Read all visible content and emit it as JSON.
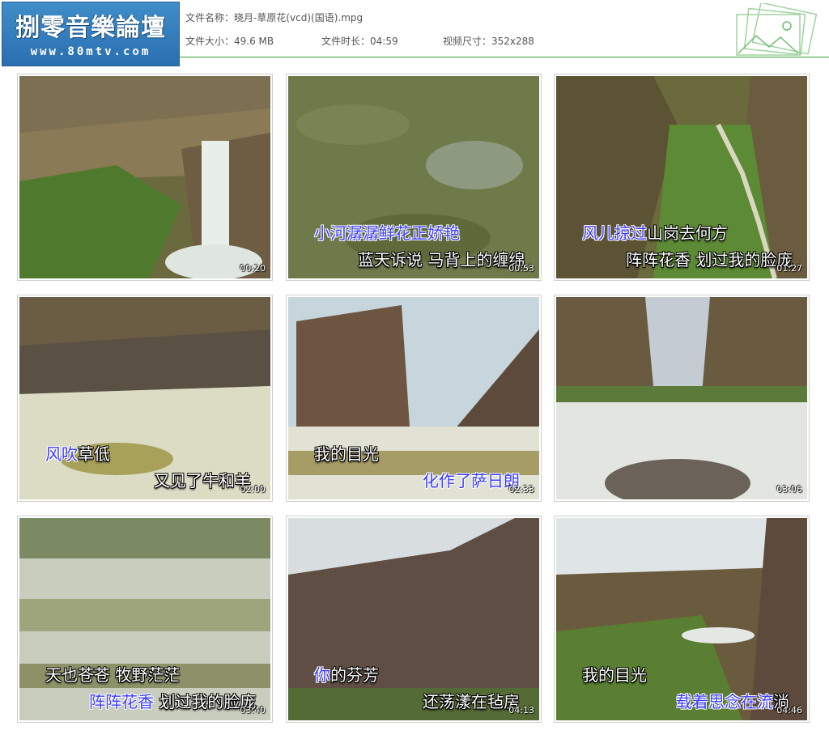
{
  "logo": {
    "title": "捌零音樂論壇",
    "url": "www.80mtv.com"
  },
  "file": {
    "name_label": "文件名称：",
    "name_value": "晓月-草原花(vcd)(国语).mpg",
    "size_label": "文件大小：",
    "size_value": "49.6 MB",
    "duration_label": "文件时长：",
    "duration_value": "04:59",
    "dims_label": "视频尺寸：",
    "dims_value": "352x288"
  },
  "thumbnails": [
    {
      "time": "00:20",
      "line1_hl": "",
      "line1_rest": "",
      "line2_hl": "",
      "line2_rest": ""
    },
    {
      "time": "00:53",
      "line1_hl": "小河潺潺鲜花正娇艳",
      "line1_rest": "",
      "line2_hl": "",
      "line2_rest": "蓝天诉说 马背上的缠绵"
    },
    {
      "time": "01:27",
      "line1_hl": "风儿掠过",
      "line1_rest": "山岗去何方",
      "line2_hl": "",
      "line2_rest": "阵阵花香 划过我的脸庞"
    },
    {
      "time": "02:00",
      "line1_hl": "风吹",
      "line1_rest": "草低",
      "line2_hl": "",
      "line2_rest": "又见了牛和羊"
    },
    {
      "time": "02:33",
      "line1_hl": "",
      "line1_rest": "我的目光",
      "line2_hl": "化作了萨日朗",
      "line2_rest": ""
    },
    {
      "time": "03:06",
      "line1_hl": "",
      "line1_rest": "",
      "line2_hl": "",
      "line2_rest": ""
    },
    {
      "time": "03:40",
      "line1_hl": "",
      "line1_rest": "天也苍苍 牧野茫茫",
      "line2_hl": "阵阵花香",
      "line2_rest": " 划过我的脸庞"
    },
    {
      "time": "04:13",
      "line1_hl": "你",
      "line1_rest": "的芬芳",
      "line2_hl": "",
      "line2_rest": "还荡漾在毡房"
    },
    {
      "time": "04:46",
      "line1_hl": "",
      "line1_rest": "我的目光",
      "line2_hl": "载着思念在流",
      "line2_rest": "淌"
    }
  ]
}
